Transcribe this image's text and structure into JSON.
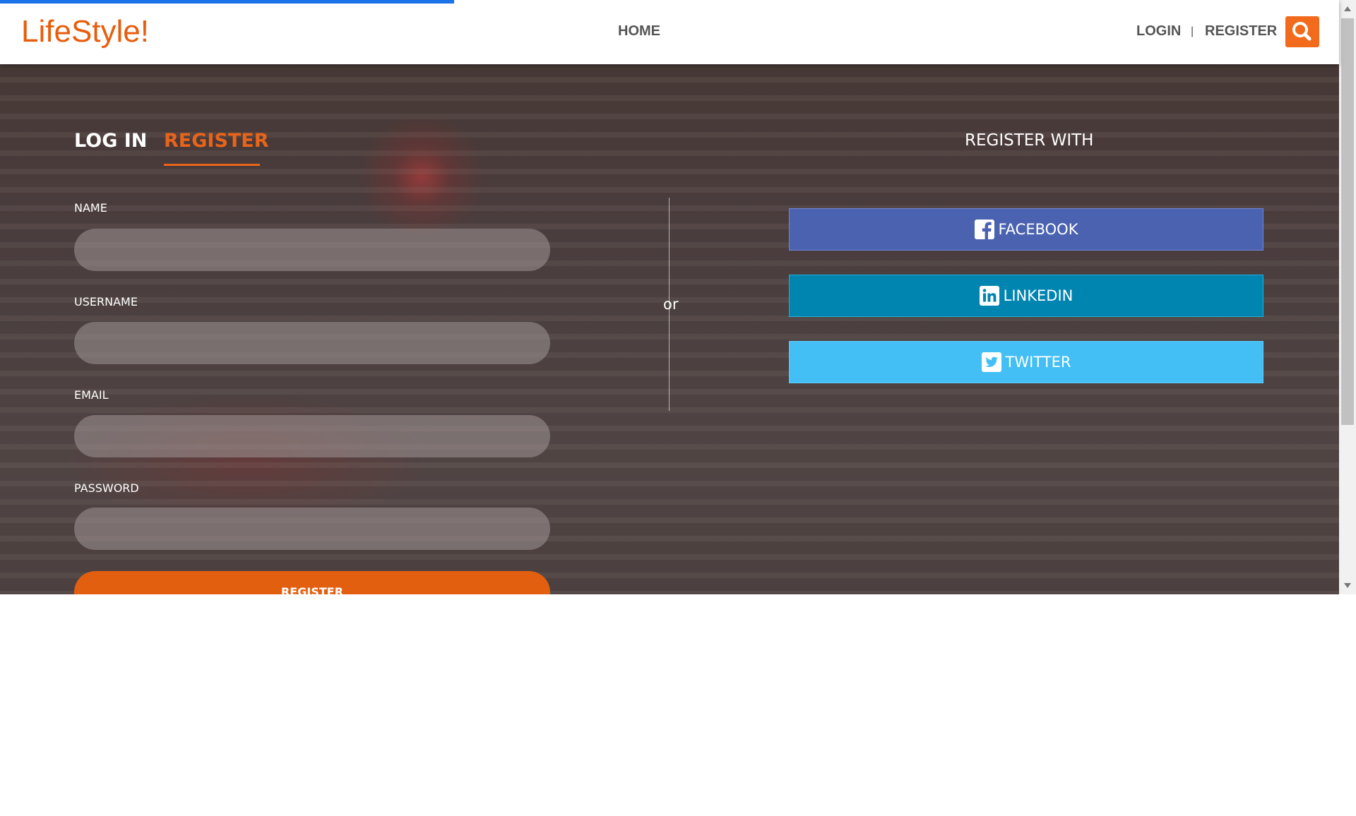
{
  "brand": {
    "logo_text": "LifeStyle!",
    "accent_color": "#e8641b"
  },
  "nav": {
    "home": "HOME",
    "login": "LOGIN",
    "separator": "|",
    "register": "REGISTER",
    "search_icon": "search-icon"
  },
  "form": {
    "tabs": [
      {
        "label": "LOG IN",
        "active": false
      },
      {
        "label": "REGISTER",
        "active": true
      }
    ],
    "fields": [
      {
        "label": "NAME",
        "value": "",
        "placeholder": ""
      },
      {
        "label": "USERNAME",
        "value": "",
        "placeholder": ""
      },
      {
        "label": "EMAIL",
        "value": "",
        "placeholder": ""
      },
      {
        "label": "PASSWORD",
        "value": "",
        "placeholder": ""
      }
    ],
    "submit_label": "REGISTER"
  },
  "divider_text": "or",
  "social": {
    "heading": "REGISTER WITH",
    "buttons": [
      {
        "label": "FACEBOOK",
        "icon": "facebook-icon",
        "color": "#4a62b0"
      },
      {
        "label": "LINKEDIN",
        "icon": "linkedin-icon",
        "color": "#0084b0"
      },
      {
        "label": "TWITTER",
        "icon": "twitter-icon",
        "color": "#43bff5"
      }
    ]
  }
}
